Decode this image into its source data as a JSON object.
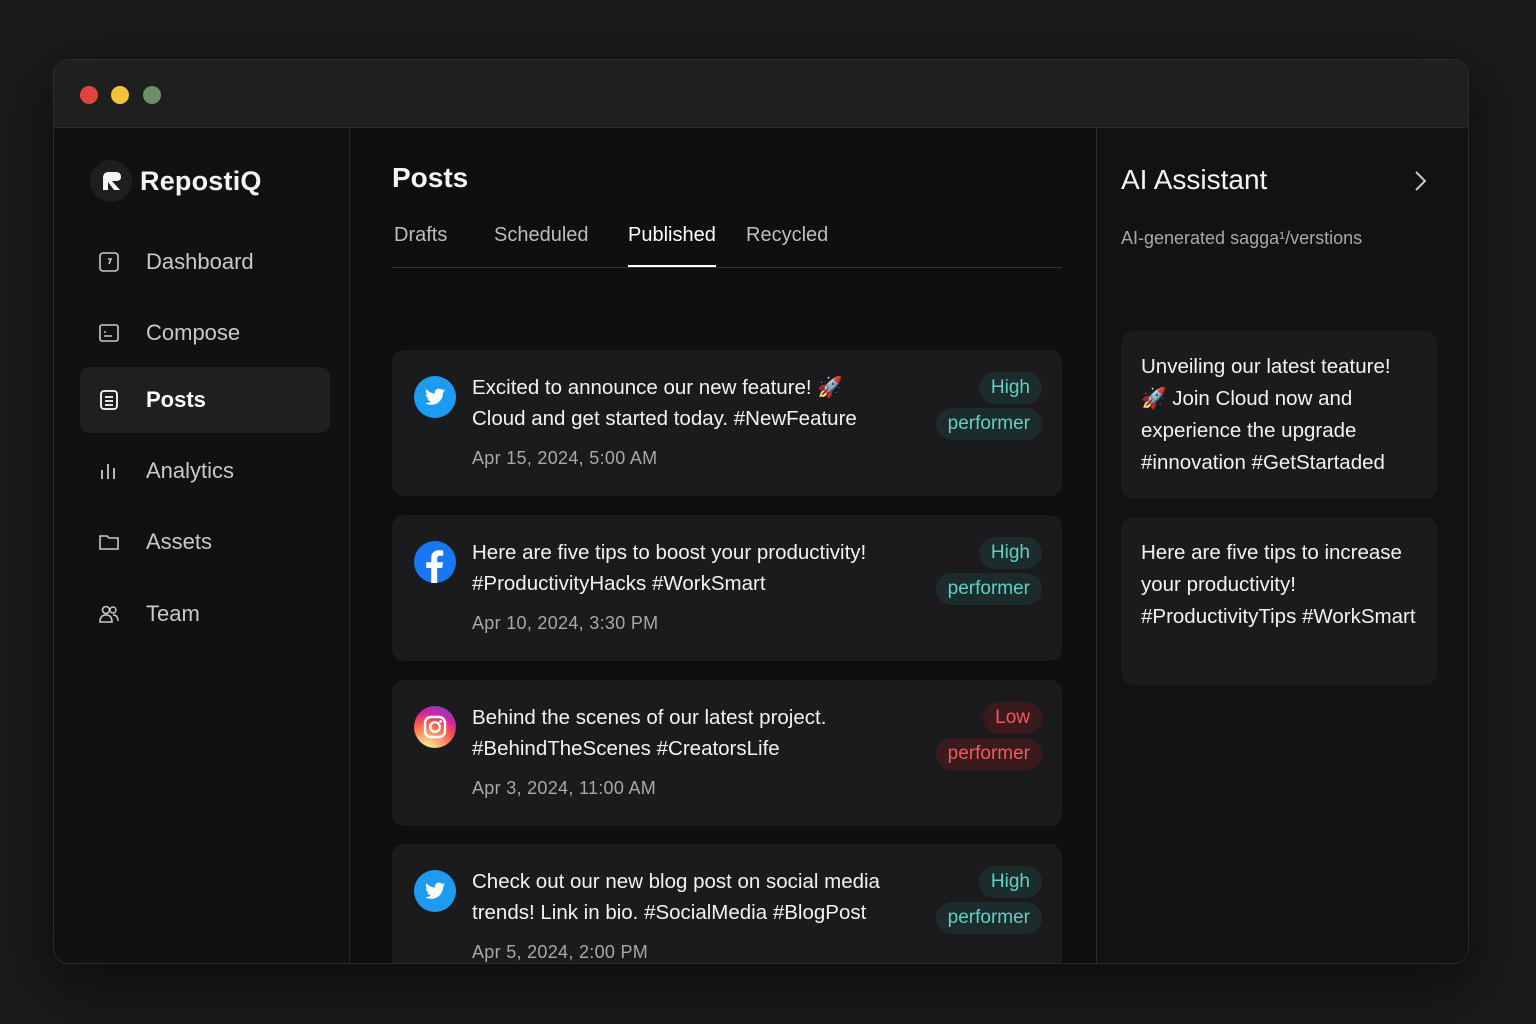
{
  "app": {
    "name": "RepostiQ"
  },
  "sidebar": {
    "items": [
      {
        "label": "Dashboard",
        "icon": "dashboard-icon"
      },
      {
        "label": "Compose",
        "icon": "compose-icon"
      },
      {
        "label": "Posts",
        "icon": "posts-icon",
        "active": true
      },
      {
        "label": "Analytics",
        "icon": "analytics-icon"
      },
      {
        "label": "Assets",
        "icon": "folder-icon"
      },
      {
        "label": "Team",
        "icon": "team-icon"
      }
    ]
  },
  "main": {
    "title": "Posts",
    "tabs": [
      {
        "label": "Drafts"
      },
      {
        "label": "Scheduled"
      },
      {
        "label": "Published",
        "active": true
      },
      {
        "label": "Recycled"
      }
    ],
    "posts": [
      {
        "platform": "twitter-icon",
        "text_line1": "Excited to announce our new feature! 🚀",
        "text_line2": "Cloud and get started today. #NewFeature",
        "date": "Apr 15, 2024, 5:00 AM",
        "badge_top": "High",
        "badge_bottom": "performer",
        "badge_color": "#5fd1c6"
      },
      {
        "platform": "facebook-icon",
        "text_line1": "Here are five tips to boost your productivity!",
        "text_line2": "#ProductivityHacks #WorkSmart",
        "date": "Apr 10, 2024, 3:30 PM",
        "badge_top": "High",
        "badge_bottom": "performer",
        "badge_color": "#5fd1c6"
      },
      {
        "platform": "instagram-icon",
        "text_line1": "Behind the scenes of our latest project.",
        "text_line2": "#BehindTheScenes #CreatorsLife",
        "date": "Apr 3, 2024, 11:00 AM",
        "badge_top": "Low",
        "badge_bottom": "performer",
        "badge_color": "#f05a5e"
      },
      {
        "platform": "twitter-icon",
        "text_line1": "Check out our new blog post on social media",
        "text_line2": "trends! Link in bio. #SocialMedia #BlogPost",
        "date": "Apr 5, 2024, 2:00 PM",
        "badge_top": "High",
        "badge_bottom": "performer",
        "badge_color": "#5fd1c6"
      }
    ]
  },
  "assistant": {
    "title": "AI Assistant",
    "subtitle": "AI-generated sagga¹/verstions",
    "suggestions": [
      {
        "text": "Unveiling our latest teature! 🚀 Join Cloud now and experience the upgrade #innovation #GetStartaded"
      },
      {
        "text": "Here are five tips to increase your productivity! #ProductivityTips #WorkSmart"
      }
    ]
  },
  "colors": {
    "background": "#0f0f10",
    "card": "#1b1b1d",
    "high": "#5fd1c6",
    "low": "#f05a5e",
    "twitter": "#1d9bf0",
    "facebook": "#1877f2"
  }
}
